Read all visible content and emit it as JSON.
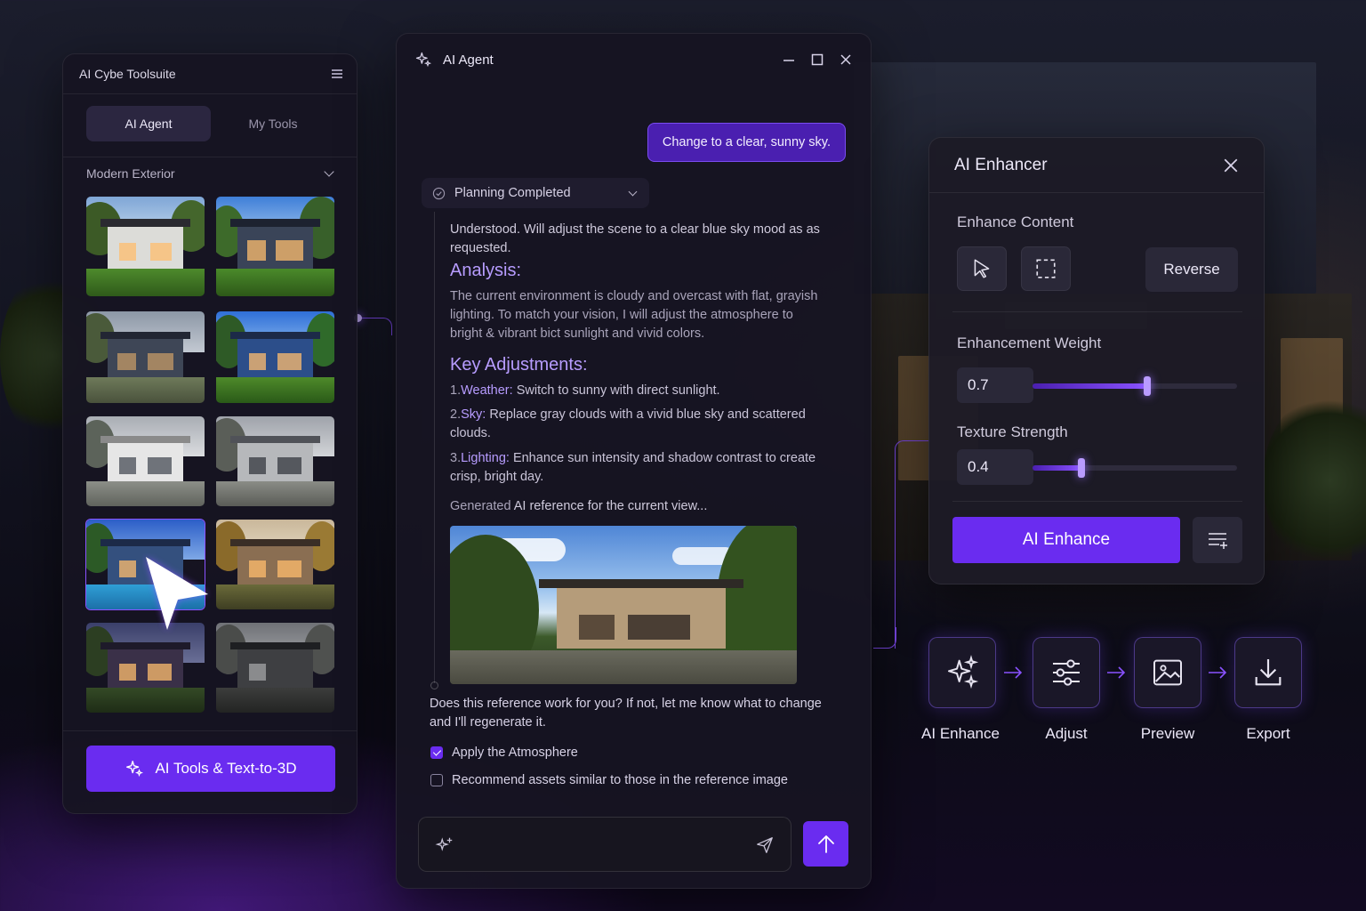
{
  "toolsuite": {
    "title": "AI Cybe Toolsuite",
    "tabs": [
      {
        "label": "AI Agent",
        "active": true
      },
      {
        "label": "My Tools",
        "active": false
      }
    ],
    "category": "Modern Exterior",
    "action_button": "AI Tools & Text-to-3D"
  },
  "agent": {
    "title": "AI Agent",
    "user_message": "Change to a clear, sunny sky.",
    "status": "Planning Completed",
    "intro": "Understood. Will adjust the scene to a clear blue sky mood as as requested.",
    "analysis_heading": "Analysis:",
    "analysis_text": "The current environment is cloudy and overcast with flat, grayish lighting. To match your vision, I will adjust the atmosphere to bright & vibrant bict sunlight and vivid colors.",
    "adjustments_heading": "Key Adjustments:",
    "adjustments": [
      {
        "num": "1.",
        "key": "Weather:",
        "text": " Switch to sunny with direct sunlight."
      },
      {
        "num": "2.",
        "key": "Sky:",
        "text": " Replace gray clouds with a vivid blue sky and scattered clouds."
      },
      {
        "num": "3.",
        "key": "Lighting:",
        "text": " Enhance sun intensity and shadow contrast to create crisp, bright day."
      }
    ],
    "generated_prefix": "Generated ",
    "generated_main": "AI reference for the current view...",
    "question": "Does this reference work for you? If not, let me know what to change and I'll regenerate it.",
    "options": [
      {
        "label": "Apply the Atmosphere",
        "checked": true
      },
      {
        "label": "Recommend assets similar to those in the reference image",
        "checked": false
      }
    ],
    "input_placeholder": ""
  },
  "enhancer": {
    "title": "AI Enhancer",
    "content_label": "Enhance Content",
    "reverse_label": "Reverse",
    "weight_label": "Enhancement Weight",
    "weight_value": "0.7",
    "weight_fraction": 0.56,
    "texture_label": "Texture Strength",
    "texture_value": "0.4",
    "texture_fraction": 0.24,
    "enhance_button": "AI Enhance"
  },
  "workflow": [
    {
      "label": "AI Enhance",
      "icon": "sparkles-icon"
    },
    {
      "label": "Adjust",
      "icon": "sliders-icon"
    },
    {
      "label": "Preview",
      "icon": "image-icon"
    },
    {
      "label": "Export",
      "icon": "download-icon"
    }
  ],
  "colors": {
    "accent": "#6a2cf0",
    "accent_light": "#b79cff",
    "panel": "#161422"
  }
}
